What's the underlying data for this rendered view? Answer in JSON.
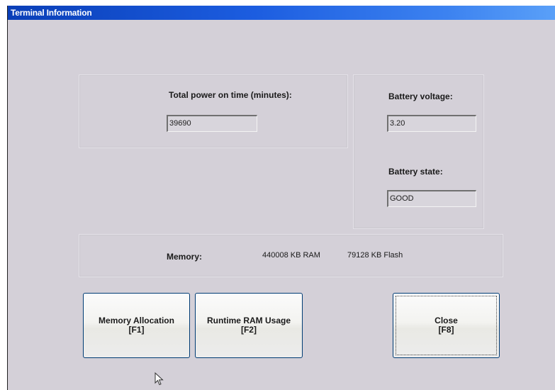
{
  "window": {
    "title": "Terminal Information"
  },
  "power": {
    "label": "Total power on time (minutes):",
    "value": "39690"
  },
  "battery": {
    "voltage_label": "Battery voltage:",
    "voltage_value": "3.20",
    "state_label": "Battery state:",
    "state_value": "GOOD"
  },
  "memory": {
    "label": "Memory:",
    "ram": "440008 KB RAM",
    "flash": "79128 KB Flash"
  },
  "buttons": {
    "memory_allocation": {
      "line1": "Memory Allocation",
      "line2": "[F1]"
    },
    "runtime_ram": {
      "line1": "Runtime RAM Usage",
      "line2": "[F2]"
    },
    "close": {
      "line1": "Close",
      "line2": "[F8]"
    }
  },
  "colors": {
    "titlebar": "#1c5de0",
    "window_bg": "#d4d0d8",
    "button_border": "#003c74"
  },
  "icons": {
    "pointer": "mouse-pointer-icon"
  }
}
